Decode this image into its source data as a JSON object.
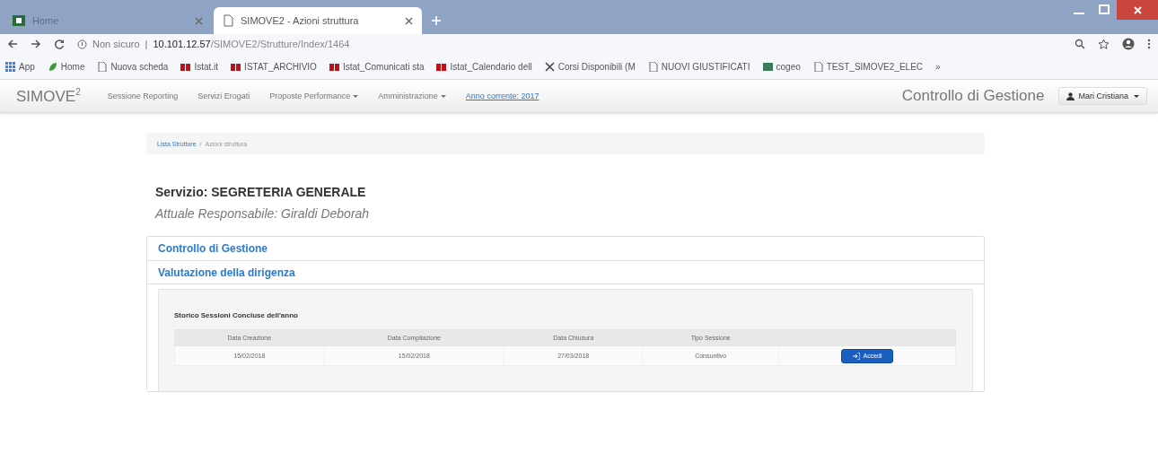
{
  "browser": {
    "tabs": [
      {
        "label": "Home",
        "selected": false
      },
      {
        "label": "SIMOVE2 - Azioni struttura",
        "selected": true
      }
    ],
    "address": {
      "security": "Non sicuro",
      "separator": "|",
      "host": "10.101.12.57",
      "path": "/SIMOVE2/Strutture/Index/1464"
    },
    "bookmarks": [
      {
        "label": "App",
        "kind": "apps"
      },
      {
        "label": "Home",
        "kind": "leaf"
      },
      {
        "label": "Nuova scheda",
        "kind": "page"
      },
      {
        "label": "Istat.it",
        "kind": "istat"
      },
      {
        "label": "ISTAT_ARCHIVIO",
        "kind": "istat"
      },
      {
        "label": "Istat_Comunicati sta",
        "kind": "istat"
      },
      {
        "label": "Istat_Calendario dell",
        "kind": "istat"
      },
      {
        "label": "Corsi Disponibili (M",
        "kind": "cross"
      },
      {
        "label": "NUOVI GIUSTIFICATI",
        "kind": "page"
      },
      {
        "label": "cogeo",
        "kind": "green"
      },
      {
        "label": "TEST_SIMOVE2_ELEC",
        "kind": "page"
      }
    ],
    "overflow": "»"
  },
  "navbar": {
    "brand": "SIMOVE$^{2}$",
    "items": [
      {
        "label": "Sessione Reporting",
        "dropdown": false
      },
      {
        "label": "Servizi Erogati",
        "dropdown": false
      },
      {
        "label": "Proposte Performance",
        "dropdown": true
      },
      {
        "label": "Amministrazione",
        "dropdown": true
      }
    ],
    "year_link": "Anno corrente: 2017",
    "section": "Controllo di Gestione",
    "user": "Mari Cristiana"
  },
  "breadcrumb": [
    {
      "label": "Lista Strutture",
      "kind": "link"
    },
    {
      "label": "/",
      "kind": "separator"
    },
    {
      "label": "Azioni struttura",
      "kind": "current"
    }
  ],
  "title": "Servizio: SEGRETERIA GENERALE",
  "subtitle": "Attuale Responsabile: Giraldi Deborah",
  "panels": [
    {
      "title": "Controllo di Gestione",
      "expanded": false
    },
    {
      "title": "Valutazione della dirigenza",
      "expanded": true
    }
  ],
  "history": {
    "title": "Storico Sessioni Concluse dell'anno",
    "columns": [
      "Data Creazione",
      "Data Compilazione",
      "Data Chiusura",
      "Tipo Sessione"
    ],
    "rows": [
      {
        "cells": [
          "15/02/2018",
          "15/02/2018",
          "27/03/2018",
          "Consuntivo"
        ],
        "action": "Accedi"
      }
    ]
  }
}
